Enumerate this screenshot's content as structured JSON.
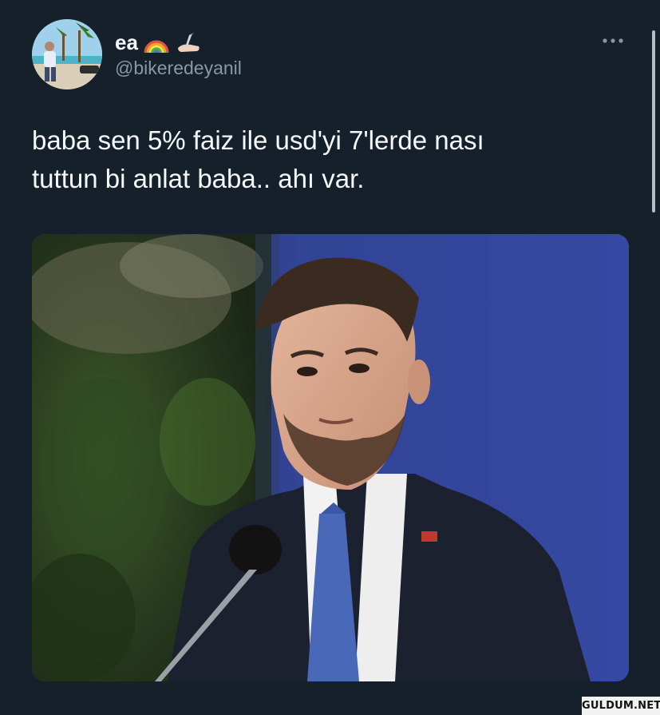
{
  "author": {
    "display_name": "ea",
    "name_emojis": [
      "rainbow-emoji",
      "writing-hand-emoji"
    ],
    "handle": "@bikeredeyanil"
  },
  "tweet": {
    "lines": [
      "baba sen 5% faiz ile usd'yi 7'lerde nası",
      "tuttun bi anlat baba.. ahı var."
    ]
  },
  "media": {
    "kind": "photo"
  },
  "watermark": {
    "text": "GULDUM.NET"
  },
  "icons": {
    "more": "more-horizontal-icon"
  },
  "colors": {
    "background": "#15202b",
    "primary_text": "#f5f8fa",
    "secondary_text": "#8899a6"
  }
}
